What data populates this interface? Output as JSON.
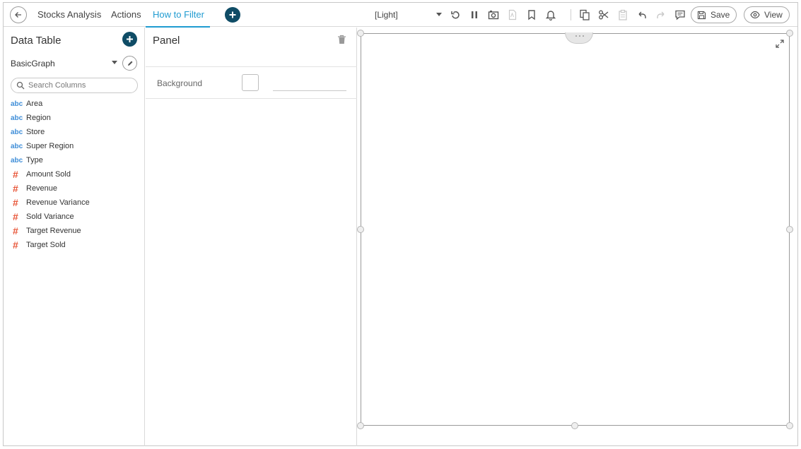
{
  "topbar": {
    "tabs": [
      {
        "label": "Stocks Analysis",
        "active": false
      },
      {
        "label": "Actions",
        "active": false
      },
      {
        "label": "How to Filter",
        "active": true
      }
    ],
    "theme": "[Light]",
    "save_label": "Save",
    "view_label": "View"
  },
  "data_table": {
    "title": "Data Table",
    "source": "BasicGraph",
    "search_placeholder": "Search Columns",
    "columns": [
      {
        "type_label": "abc",
        "name": "Area"
      },
      {
        "type_label": "abc",
        "name": "Region"
      },
      {
        "type_label": "abc",
        "name": "Store"
      },
      {
        "type_label": "abc",
        "name": "Super Region"
      },
      {
        "type_label": "abc",
        "name": "Type"
      },
      {
        "type_label": "#",
        "name": "Amount Sold"
      },
      {
        "type_label": "#",
        "name": "Revenue"
      },
      {
        "type_label": "#",
        "name": "Revenue Variance"
      },
      {
        "type_label": "#",
        "name": "Sold Variance"
      },
      {
        "type_label": "#",
        "name": "Target Revenue"
      },
      {
        "type_label": "#",
        "name": "Target Sold"
      }
    ]
  },
  "panel": {
    "title": "Panel",
    "background_label": "Background",
    "background_value": ""
  },
  "colors": {
    "accent": "#1f9bd1",
    "dark_button": "#0f4c66",
    "text_type": "#3f8ed8",
    "numeric_type": "#e8573a"
  },
  "icons": {
    "back": "arrow-left-icon",
    "refresh": "refresh-icon",
    "pause": "pause-icon",
    "snapshot": "camera-icon",
    "pdf": "pdf-icon",
    "bookmark": "bookmark-icon",
    "alert": "bell-icon",
    "copy": "copy-icon",
    "cut": "scissors-icon",
    "paste": "clipboard-icon",
    "undo": "undo-icon",
    "redo": "redo-icon",
    "comment": "comment-icon",
    "save": "save-icon",
    "view": "eye-icon",
    "search": "search-icon",
    "edit": "pencil-icon",
    "delete": "trash-icon",
    "expand": "expand-icon"
  }
}
